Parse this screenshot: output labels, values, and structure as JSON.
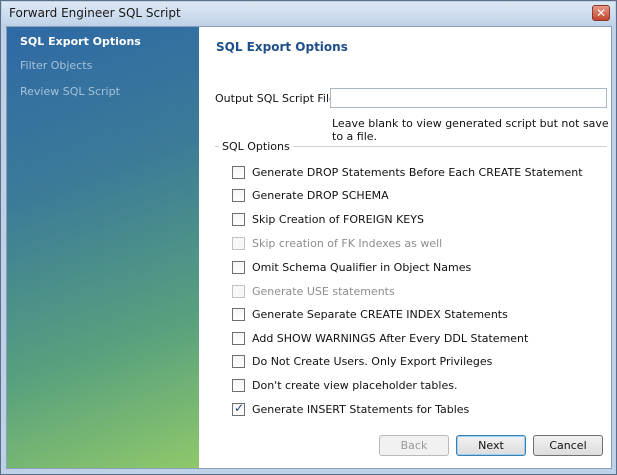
{
  "window": {
    "title": "Forward Engineer SQL Script"
  },
  "sidebar": {
    "items": [
      {
        "label": "SQL Export Options",
        "active": true
      },
      {
        "label": "Filter Objects",
        "active": false
      },
      {
        "label": "Review SQL Script",
        "active": false
      }
    ]
  },
  "page": {
    "heading": "SQL Export Options",
    "output_label": "Output SQL Script File:",
    "output_value": "",
    "output_hint": "Leave blank to view generated script but not save to a file.",
    "options_group": "SQL Options",
    "options": [
      {
        "label": "Generate DROP Statements Before Each CREATE Statement",
        "checked": false,
        "enabled": true
      },
      {
        "label": "Generate DROP SCHEMA",
        "checked": false,
        "enabled": true
      },
      {
        "label": "Skip Creation of FOREIGN KEYS",
        "checked": false,
        "enabled": true
      },
      {
        "label": "Skip creation of FK Indexes as well",
        "checked": false,
        "enabled": false
      },
      {
        "label": "Omit Schema Qualifier in Object Names",
        "checked": false,
        "enabled": true
      },
      {
        "label": "Generate USE statements",
        "checked": false,
        "enabled": false
      },
      {
        "label": "Generate Separate CREATE INDEX Statements",
        "checked": false,
        "enabled": true
      },
      {
        "label": "Add SHOW WARNINGS After Every DDL Statement",
        "checked": false,
        "enabled": true
      },
      {
        "label": "Do Not Create Users. Only Export Privileges",
        "checked": false,
        "enabled": true
      },
      {
        "label": "Don't create view placeholder tables.",
        "checked": false,
        "enabled": true
      },
      {
        "label": "Generate INSERT Statements for Tables",
        "checked": true,
        "enabled": true
      }
    ]
  },
  "buttons": {
    "back": "Back",
    "next": "Next",
    "cancel": "Cancel"
  }
}
